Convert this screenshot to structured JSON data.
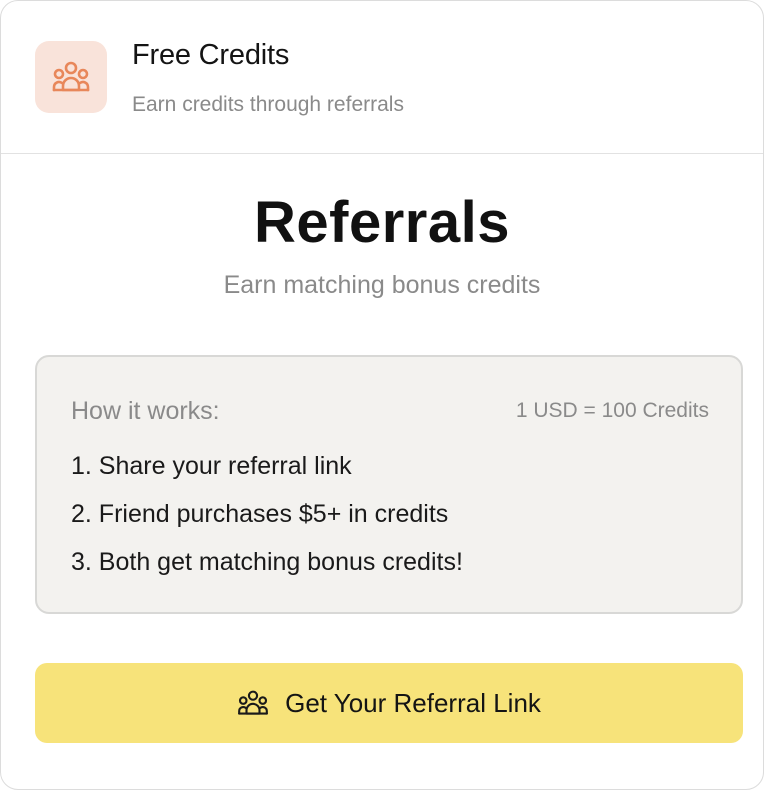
{
  "header": {
    "icon": "users-group-icon",
    "title": "Free Credits",
    "subtitle": "Earn credits through referrals",
    "icon_color": "#e8875a",
    "icon_bg": "#f9e3da"
  },
  "main": {
    "title": "Referrals",
    "subtitle": "Earn matching bonus credits"
  },
  "how_it_works": {
    "title": "How it works:",
    "rate": "1 USD = 100 Credits",
    "steps": [
      "1. Share your referral link",
      "2. Friend purchases $5+ in credits",
      "3. Both get matching bonus credits!"
    ]
  },
  "cta": {
    "icon": "users-group-icon",
    "label": "Get Your Referral Link",
    "color": "#f7e37a"
  }
}
